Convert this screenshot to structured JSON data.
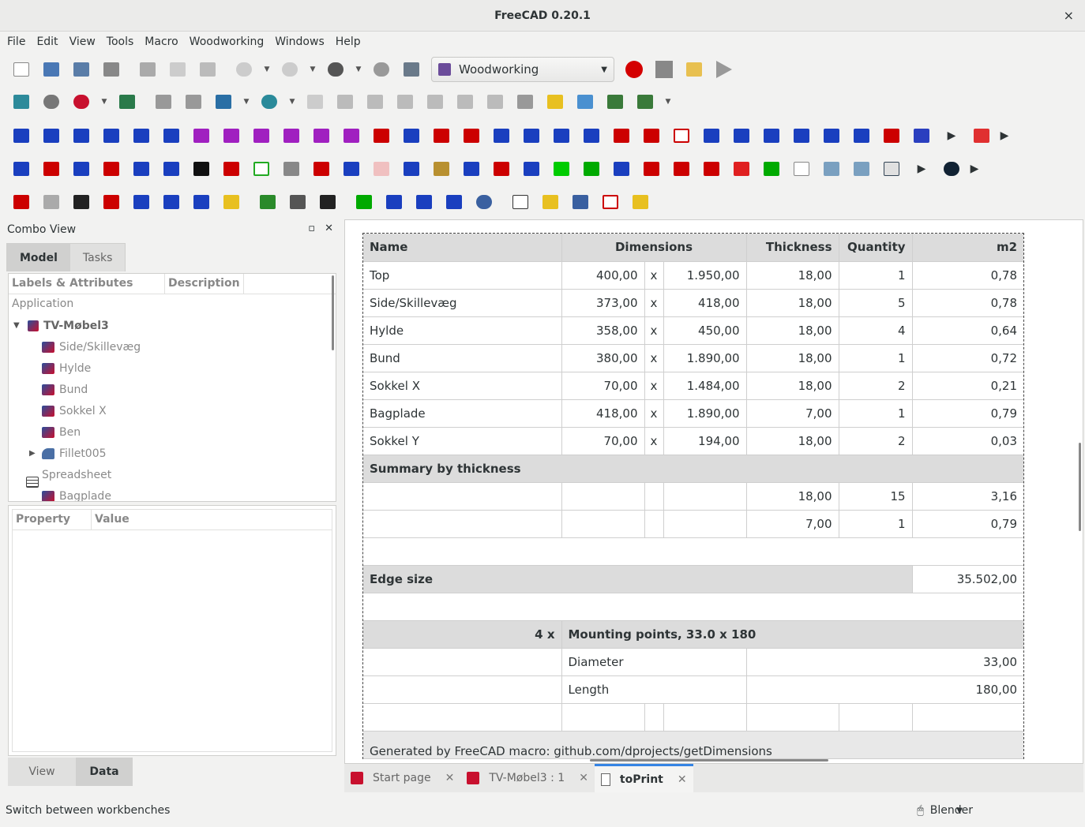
{
  "window": {
    "title": "FreeCAD 0.20.1",
    "close": "×"
  },
  "menu": [
    "File",
    "Edit",
    "View",
    "Tools",
    "Macro",
    "Woodworking",
    "Windows",
    "Help"
  ],
  "toolbar": {
    "workbench": "Woodworking"
  },
  "combo": {
    "title": "Combo View",
    "tabs": [
      "Model",
      "Tasks"
    ],
    "tree_headers": [
      "Labels & Attributes",
      "Description"
    ],
    "app_label": "Application",
    "root": "TV-Møbel3",
    "items": [
      "Side/Skillevæg",
      "Hylde",
      "Bund",
      "Sokkel X",
      "Ben",
      "Fillet005",
      "Spreadsheet",
      "Bagplade"
    ],
    "prop_headers": [
      "Property",
      "Value"
    ],
    "bottom_tabs": [
      "View",
      "Data"
    ]
  },
  "sheet": {
    "headers": [
      "Name",
      "Dimensions",
      "Thickness",
      "Quantity",
      "m2"
    ],
    "rows": [
      [
        "Top",
        "400,00",
        "x",
        "1.950,00",
        "18,00",
        "1",
        "0,78"
      ],
      [
        "Side/Skillevæg",
        "373,00",
        "x",
        "418,00",
        "18,00",
        "5",
        "0,78"
      ],
      [
        "Hylde",
        "358,00",
        "x",
        "450,00",
        "18,00",
        "4",
        "0,64"
      ],
      [
        "Bund",
        "380,00",
        "x",
        "1.890,00",
        "18,00",
        "1",
        "0,72"
      ],
      [
        "Sokkel X",
        "70,00",
        "x",
        "1.484,00",
        "18,00",
        "2",
        "0,21"
      ],
      [
        "Bagplade",
        "418,00",
        "x",
        "1.890,00",
        "7,00",
        "1",
        "0,79"
      ],
      [
        "Sokkel Y",
        "70,00",
        "x",
        "194,00",
        "18,00",
        "2",
        "0,03"
      ]
    ],
    "summary_title": "Summary by thickness",
    "summary": [
      [
        "18,00",
        "15",
        "3,16"
      ],
      [
        "7,00",
        "1",
        "0,79"
      ]
    ],
    "edge_label": "Edge size",
    "edge_value": "35.502,00",
    "mount_count": "4 x",
    "mount_title": "Mounting points, 33.0 x 180",
    "mount_rows": [
      [
        "Diameter",
        "33,00"
      ],
      [
        "Length",
        "180,00"
      ]
    ],
    "footer": "Generated by FreeCAD macro: github.com/dprojects/getDimensions"
  },
  "doctabs": [
    "Start page",
    "TV-Møbel3 : 1",
    "toPrint"
  ],
  "status": {
    "text": "Switch between workbenches",
    "nav": "Blender"
  }
}
